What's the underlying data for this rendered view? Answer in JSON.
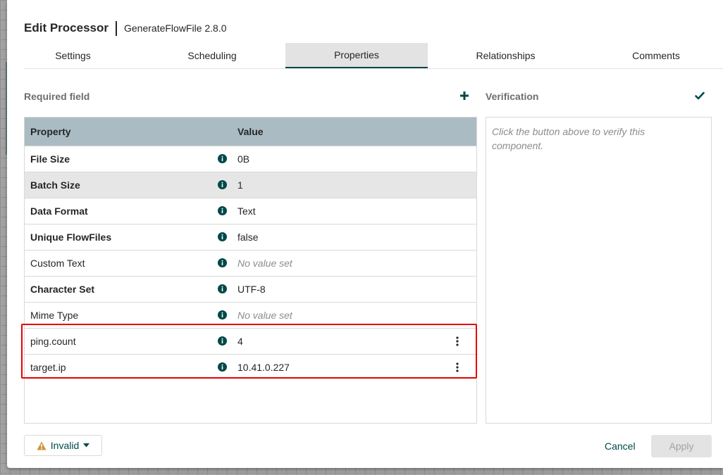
{
  "dialog": {
    "title": "Edit Processor",
    "subtitle": "GenerateFlowFile 2.8.0"
  },
  "tabs": [
    {
      "label": "Settings"
    },
    {
      "label": "Scheduling"
    },
    {
      "label": "Properties",
      "active": true
    },
    {
      "label": "Relationships"
    },
    {
      "label": "Comments"
    }
  ],
  "properties": {
    "required_label": "Required field",
    "add_icon": "plus-icon",
    "columns": {
      "property": "Property",
      "value": "Value"
    },
    "rows": [
      {
        "name": "File Size",
        "value": "0B"
      },
      {
        "name": "Batch Size",
        "value": "1"
      },
      {
        "name": "Data Format",
        "value": "Text"
      },
      {
        "name": "Unique FlowFiles",
        "value": "false"
      },
      {
        "name": "Custom Text",
        "value": "No value set"
      },
      {
        "name": "Character Set",
        "value": "UTF-8"
      },
      {
        "name": "Mime Type",
        "value": "No value set"
      },
      {
        "name": "ping.count",
        "value": "4"
      },
      {
        "name": "target.ip",
        "value": "10.41.0.227"
      }
    ]
  },
  "verification": {
    "label": "Verification",
    "icon": "checkmark-icon",
    "placeholder": "Click the button above to verify this component."
  },
  "footer": {
    "status_label": "Invalid",
    "cancel_label": "Cancel",
    "apply_label": "Apply"
  },
  "colors": {
    "accent": "#004849",
    "header_bg": "#aabbc3",
    "highlight": "#e60000",
    "warning": "#cf9338"
  }
}
